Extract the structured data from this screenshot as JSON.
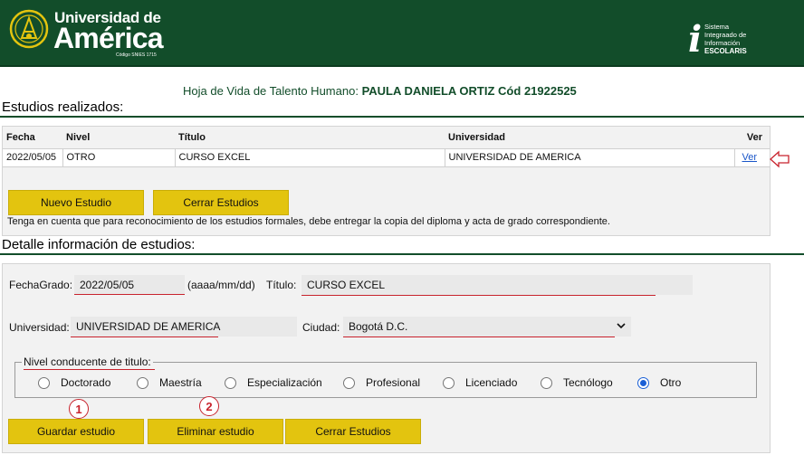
{
  "header": {
    "logo_line1": "Universidad de",
    "logo_line2": "América",
    "logo_code": "Código SNIES 1715",
    "system_letter": "i",
    "system_line1": "Sistema",
    "system_line2": "Integraado de",
    "system_line3": "Información",
    "system_line4": "ESCOLARIS",
    "brand_color": "#124d2a"
  },
  "profile": {
    "prefix": "Hoja de Vida de Talento Humano:",
    "name": "PAULA DANIELA ORTIZ",
    "code_label": "Cód",
    "code": "21922525"
  },
  "studies": {
    "section_title": "Estudios realizados:",
    "columns": [
      "Fecha",
      "Nivel",
      "Título",
      "Universidad",
      "Ver"
    ],
    "rows": [
      {
        "fecha": "2022/05/05",
        "nivel": "OTRO",
        "titulo": "CURSO EXCEL",
        "universidad": "UNIVERSIDAD DE AMERICA",
        "ver": "Ver"
      }
    ],
    "new_button": "Nuevo Estudio",
    "close_button": "Cerrar Estudios",
    "note": "Tenga en cuenta que para reconocimiento de los estudios formales, debe entregar la copia del diploma y acta de grado correspondiente."
  },
  "detail": {
    "section_title": "Detalle información de estudios:",
    "fecha_label": "FechaGrado:",
    "fecha_value": "2022/05/05",
    "fecha_hint": "(aaaa/mm/dd)",
    "titulo_label": "Título:",
    "titulo_value": "CURSO EXCEL",
    "universidad_label": "Universidad:",
    "universidad_value": "UNIVERSIDAD DE AMERICA",
    "ciudad_label": "Ciudad:",
    "ciudad_value": "Bogotá D.C.",
    "nivel_legend": "Nivel conducente de titulo:",
    "niveles": [
      "Doctorado",
      "Maestría",
      "Especialización",
      "Profesional",
      "Licenciado",
      "Tecnólogo",
      "Otro"
    ],
    "nivel_selected": "Otro",
    "save_button": "Guardar estudio",
    "delete_button": "Eliminar estudio",
    "close_button": "Cerrar Estudios",
    "badge_1": "1",
    "badge_2": "2"
  },
  "colors": {
    "accent_yellow": "#e3c40f",
    "underline_red": "#c8232d",
    "radio_blue": "#1a5fd6"
  }
}
